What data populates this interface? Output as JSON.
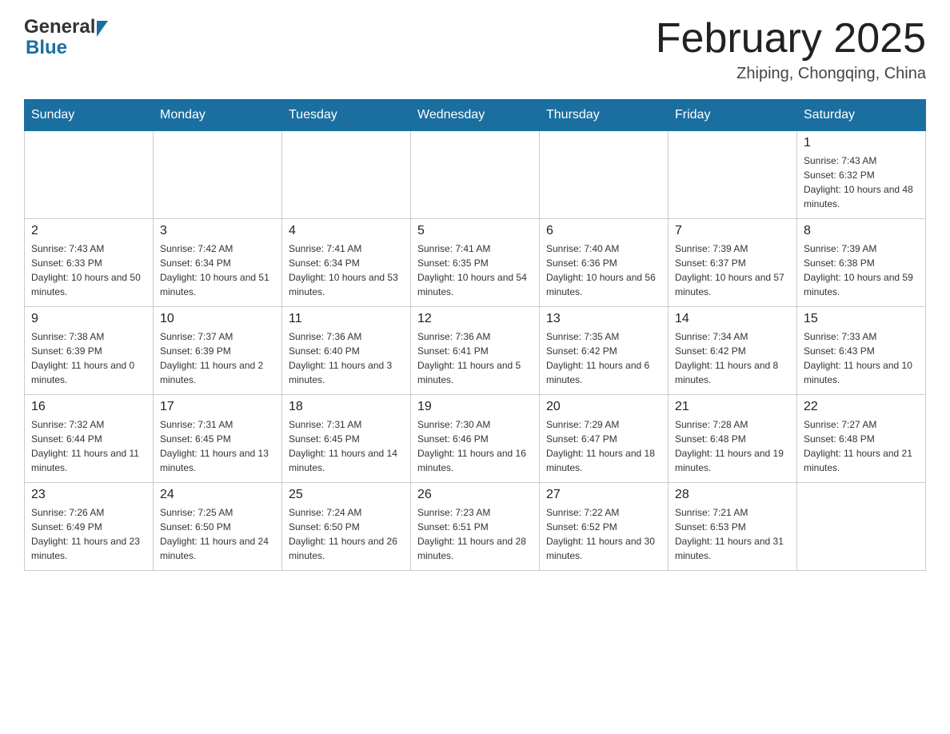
{
  "header": {
    "logo_general": "General",
    "logo_blue": "Blue",
    "title": "February 2025",
    "subtitle": "Zhiping, Chongqing, China"
  },
  "calendar": {
    "days_of_week": [
      "Sunday",
      "Monday",
      "Tuesday",
      "Wednesday",
      "Thursday",
      "Friday",
      "Saturday"
    ],
    "weeks": [
      [
        {
          "day": "",
          "info": ""
        },
        {
          "day": "",
          "info": ""
        },
        {
          "day": "",
          "info": ""
        },
        {
          "day": "",
          "info": ""
        },
        {
          "day": "",
          "info": ""
        },
        {
          "day": "",
          "info": ""
        },
        {
          "day": "1",
          "info": "Sunrise: 7:43 AM\nSunset: 6:32 PM\nDaylight: 10 hours and 48 minutes."
        }
      ],
      [
        {
          "day": "2",
          "info": "Sunrise: 7:43 AM\nSunset: 6:33 PM\nDaylight: 10 hours and 50 minutes."
        },
        {
          "day": "3",
          "info": "Sunrise: 7:42 AM\nSunset: 6:34 PM\nDaylight: 10 hours and 51 minutes."
        },
        {
          "day": "4",
          "info": "Sunrise: 7:41 AM\nSunset: 6:34 PM\nDaylight: 10 hours and 53 minutes."
        },
        {
          "day": "5",
          "info": "Sunrise: 7:41 AM\nSunset: 6:35 PM\nDaylight: 10 hours and 54 minutes."
        },
        {
          "day": "6",
          "info": "Sunrise: 7:40 AM\nSunset: 6:36 PM\nDaylight: 10 hours and 56 minutes."
        },
        {
          "day": "7",
          "info": "Sunrise: 7:39 AM\nSunset: 6:37 PM\nDaylight: 10 hours and 57 minutes."
        },
        {
          "day": "8",
          "info": "Sunrise: 7:39 AM\nSunset: 6:38 PM\nDaylight: 10 hours and 59 minutes."
        }
      ],
      [
        {
          "day": "9",
          "info": "Sunrise: 7:38 AM\nSunset: 6:39 PM\nDaylight: 11 hours and 0 minutes."
        },
        {
          "day": "10",
          "info": "Sunrise: 7:37 AM\nSunset: 6:39 PM\nDaylight: 11 hours and 2 minutes."
        },
        {
          "day": "11",
          "info": "Sunrise: 7:36 AM\nSunset: 6:40 PM\nDaylight: 11 hours and 3 minutes."
        },
        {
          "day": "12",
          "info": "Sunrise: 7:36 AM\nSunset: 6:41 PM\nDaylight: 11 hours and 5 minutes."
        },
        {
          "day": "13",
          "info": "Sunrise: 7:35 AM\nSunset: 6:42 PM\nDaylight: 11 hours and 6 minutes."
        },
        {
          "day": "14",
          "info": "Sunrise: 7:34 AM\nSunset: 6:42 PM\nDaylight: 11 hours and 8 minutes."
        },
        {
          "day": "15",
          "info": "Sunrise: 7:33 AM\nSunset: 6:43 PM\nDaylight: 11 hours and 10 minutes."
        }
      ],
      [
        {
          "day": "16",
          "info": "Sunrise: 7:32 AM\nSunset: 6:44 PM\nDaylight: 11 hours and 11 minutes."
        },
        {
          "day": "17",
          "info": "Sunrise: 7:31 AM\nSunset: 6:45 PM\nDaylight: 11 hours and 13 minutes."
        },
        {
          "day": "18",
          "info": "Sunrise: 7:31 AM\nSunset: 6:45 PM\nDaylight: 11 hours and 14 minutes."
        },
        {
          "day": "19",
          "info": "Sunrise: 7:30 AM\nSunset: 6:46 PM\nDaylight: 11 hours and 16 minutes."
        },
        {
          "day": "20",
          "info": "Sunrise: 7:29 AM\nSunset: 6:47 PM\nDaylight: 11 hours and 18 minutes."
        },
        {
          "day": "21",
          "info": "Sunrise: 7:28 AM\nSunset: 6:48 PM\nDaylight: 11 hours and 19 minutes."
        },
        {
          "day": "22",
          "info": "Sunrise: 7:27 AM\nSunset: 6:48 PM\nDaylight: 11 hours and 21 minutes."
        }
      ],
      [
        {
          "day": "23",
          "info": "Sunrise: 7:26 AM\nSunset: 6:49 PM\nDaylight: 11 hours and 23 minutes."
        },
        {
          "day": "24",
          "info": "Sunrise: 7:25 AM\nSunset: 6:50 PM\nDaylight: 11 hours and 24 minutes."
        },
        {
          "day": "25",
          "info": "Sunrise: 7:24 AM\nSunset: 6:50 PM\nDaylight: 11 hours and 26 minutes."
        },
        {
          "day": "26",
          "info": "Sunrise: 7:23 AM\nSunset: 6:51 PM\nDaylight: 11 hours and 28 minutes."
        },
        {
          "day": "27",
          "info": "Sunrise: 7:22 AM\nSunset: 6:52 PM\nDaylight: 11 hours and 30 minutes."
        },
        {
          "day": "28",
          "info": "Sunrise: 7:21 AM\nSunset: 6:53 PM\nDaylight: 11 hours and 31 minutes."
        },
        {
          "day": "",
          "info": ""
        }
      ]
    ]
  }
}
